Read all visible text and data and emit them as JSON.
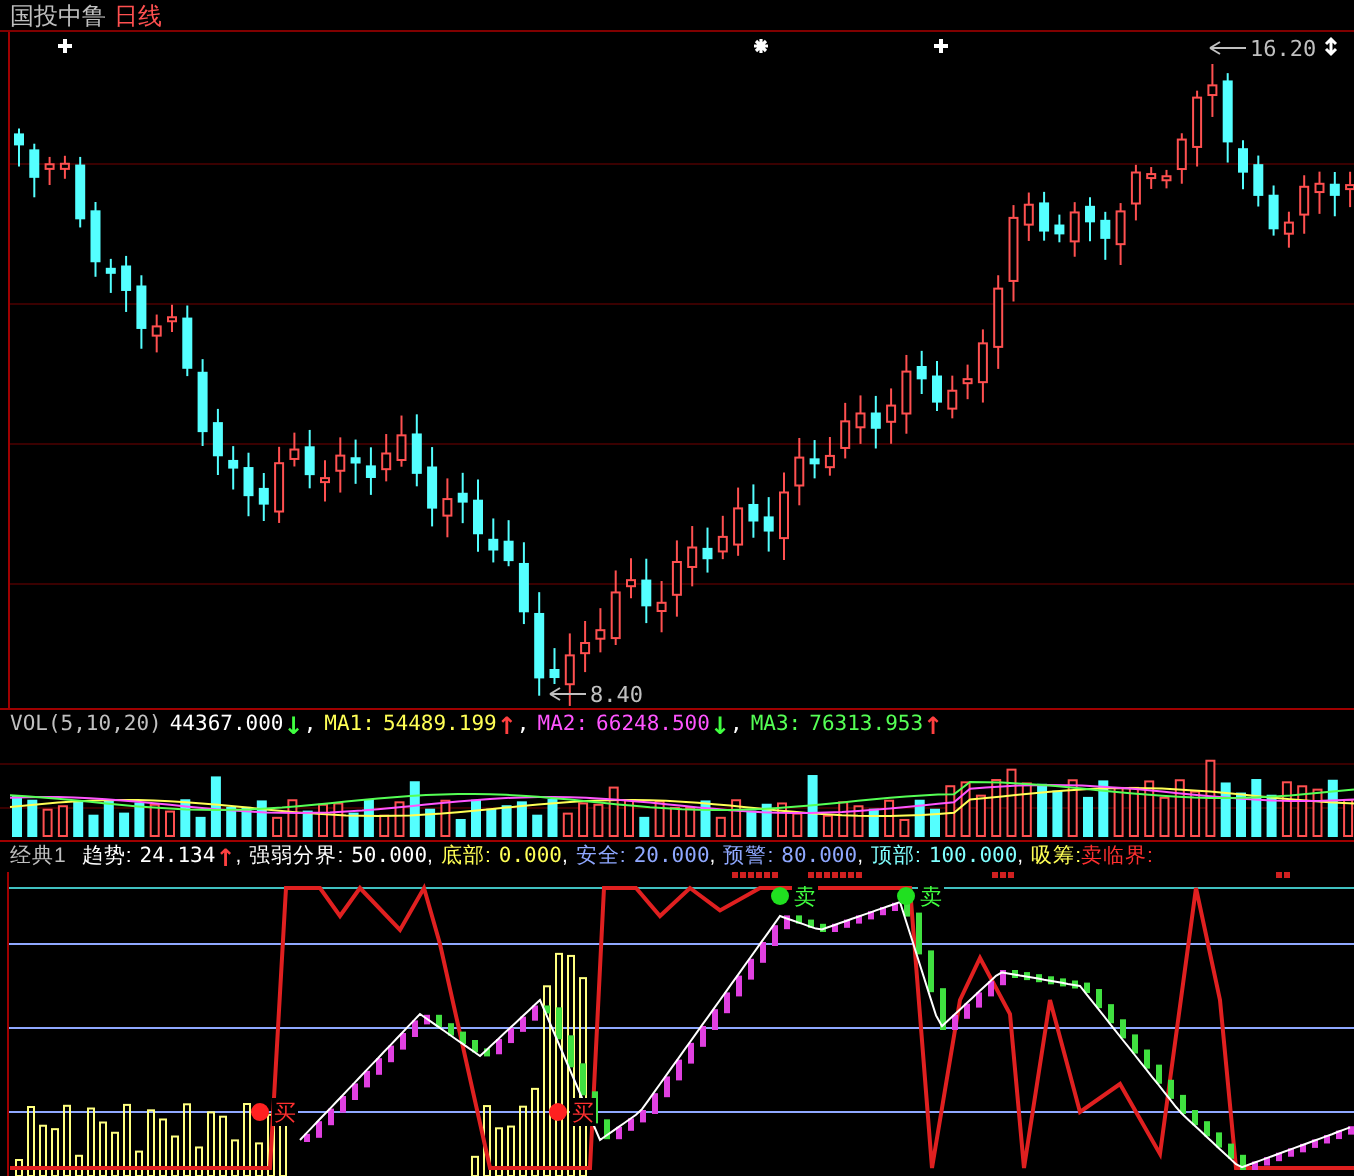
{
  "title": {
    "stock": "国投中鲁",
    "period": "日线"
  },
  "price_chart": {
    "high_label": "16.20",
    "low_label": "8.40"
  },
  "volume_panel": {
    "indicator": "VOL(5,10,20)",
    "value": "44367.000",
    "arrow": {
      "text": "↓",
      "color": "#40ff40"
    },
    "sep": ",",
    "ma": [
      {
        "label": "MA1:",
        "value": "54489.199",
        "arrow": {
          "text": "↑",
          "color": "#ff4040"
        },
        "sep": ",",
        "color": "#ffff55"
      },
      {
        "label": "MA2:",
        "value": "66248.500",
        "arrow": {
          "text": "↓",
          "color": "#40ff40"
        },
        "sep": ",",
        "color": "#ff55ff"
      },
      {
        "label": "MA3:",
        "value": "76313.953",
        "arrow": {
          "text": "↑",
          "color": "#ff4040"
        },
        "color": "#55ff55"
      }
    ]
  },
  "oscillator_panel": {
    "name": "经典1",
    "fields": [
      {
        "label": "趋势:",
        "value": "24.134",
        "arrow": {
          "text": "↑",
          "color": "#ff4040"
        },
        "sep": ",",
        "color": "#ffffff"
      },
      {
        "label": "强弱分界:",
        "value": "50.000",
        "sep": ",",
        "color": "#ffffff"
      },
      {
        "label": "底部:",
        "value": "0.000",
        "sep": ",",
        "color": "#ffff55"
      },
      {
        "label": "安全:",
        "value": "20.000",
        "sep": ",",
        "color": "#8fa8ff"
      },
      {
        "label": "预警:",
        "value": "80.000",
        "sep": ",",
        "color": "#8fa8ff"
      },
      {
        "label": "顶部:",
        "value": "100.000",
        "sep": ",",
        "color": "#80ffff"
      },
      {
        "label": "吸筹:",
        "color": "#ffff55"
      },
      {
        "label": "卖临界:",
        "color": "#ff3030"
      }
    ],
    "signals": [
      {
        "kind": "buy",
        "text": "买"
      },
      {
        "kind": "buy",
        "text": "买"
      },
      {
        "kind": "sell",
        "text": "卖"
      },
      {
        "kind": "sell",
        "text": "卖"
      }
    ]
  }
}
